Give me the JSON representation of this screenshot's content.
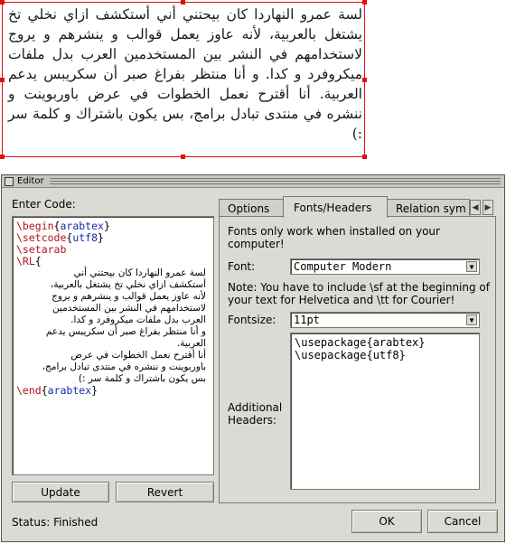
{
  "preview": {
    "text": "لسة عمرو النهاردا كان بيحتني أني أستكشف ازاي نخلي تخ يشتغل بالعربية، لأنه عاوز يعمل قوالب و ينشرهم و يروج لاستخدامهم في النشر بين المستخدمين العرب بدل ملفات ميكروفرد و كدا. و أنا منتظر بفراغ صبر أن سكريبس يدعم العربية. أنا أقترح نعمل الخطوات في عرض باوربوينت و ننشره في منتدى تبادل برامج، بس يكون باشتراك و كلمة سر :)"
  },
  "editor": {
    "title": "Editor",
    "enter_code_label": "Enter Code:",
    "code": {
      "line1_cmd": "\\begin",
      "line1_arg": "arabtex",
      "line2_cmd": "\\setcode",
      "line2_arg": "utf8",
      "line3_cmd": "\\setarab",
      "line4_cmd": "\\RL",
      "arabic_lines": [
        "لسة عمرو النهاردا كان بيحتني أني",
        "أستكشف ازاي نخلي تخ يشتغل بالعربية،",
        "لأنه عاوز يعمل قوالب و ينشرهم و يروج",
        "لاستخدامهم في النشر بين المستخدمين",
        "العرب بدل ملفات ميكروفرد و كدا.",
        "و أنا منتظر بفراغ صبر أن سكريبس يدعم",
        "العربية.",
        "أنا أقترح نعمل الخطوات في عرض",
        "باوربوينت و ننشره في منتدى تبادل برامج،",
        "بس يكون باشتراك و كلمة سر :)"
      ],
      "last_cmd": "\\end",
      "last_arg": "arabtex"
    },
    "update_label": "Update",
    "revert_label": "Revert",
    "status": "Status: Finished",
    "tabs": [
      "Options",
      "Fonts/Headers",
      "Relation sym"
    ],
    "active_tab": "Fonts/Headers",
    "fonts_note": "Fonts only work when installed on your computer!",
    "font_label": "Font:",
    "font_value": "Computer Modern",
    "sf_note": "Note: You have to include \\sf at the beginning of your text for Helvetica and \\tt for Courier!",
    "fontsize_label": "Fontsize:",
    "fontsize_value": "11pt",
    "additional_headers_label": "Additional Headers:",
    "headers": [
      "\\usepackage{arabtex}",
      "\\usepackage{utf8}"
    ],
    "ok_label": "OK",
    "cancel_label": "Cancel",
    "colors": {
      "command": "#b0131b",
      "argument": "#1c2aa6",
      "selection": "#e01010"
    }
  }
}
